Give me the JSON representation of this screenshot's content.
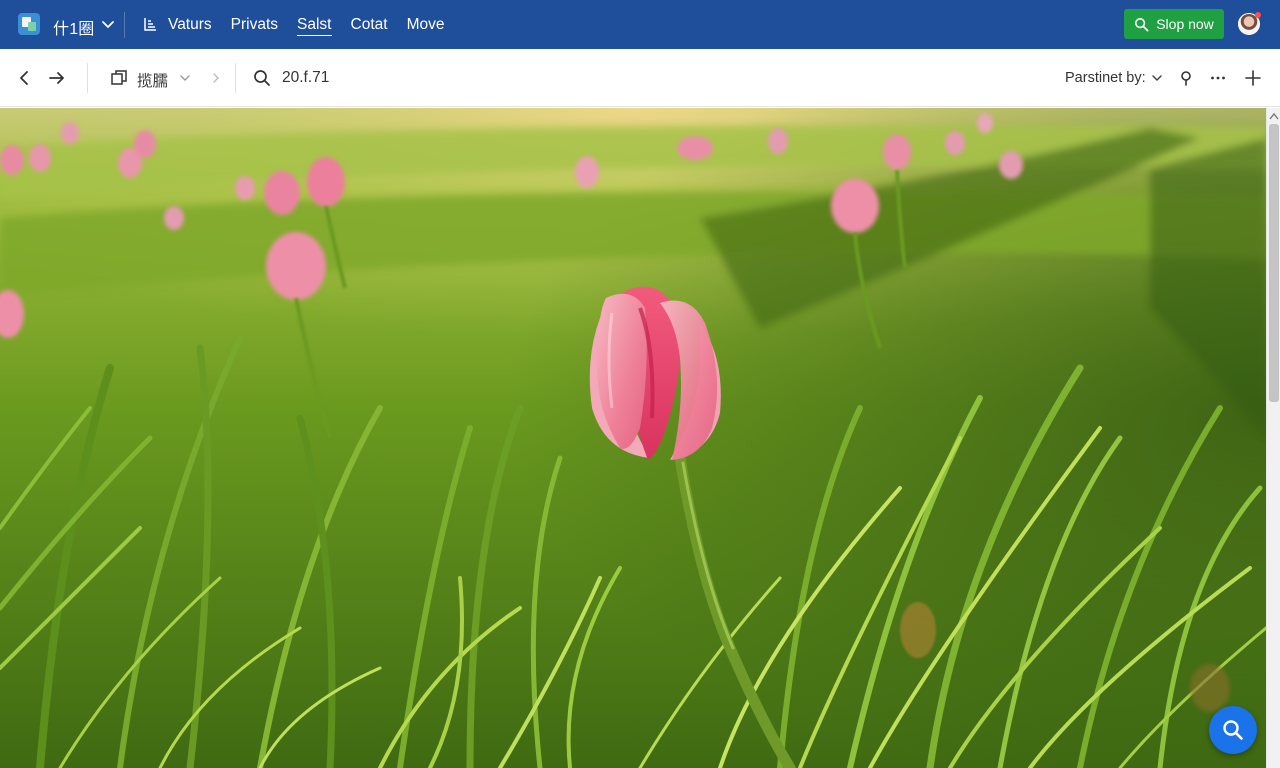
{
  "topbar": {
    "workspace": "什1圈",
    "nav": [
      {
        "label": "Vaturs",
        "active": false
      },
      {
        "label": "Privats",
        "active": false
      },
      {
        "label": "Salst",
        "active": true
      },
      {
        "label": "Cotat",
        "active": false
      },
      {
        "label": "Move",
        "active": false
      }
    ],
    "cta_label": "Slop now",
    "colors": {
      "bar": "#1f4e9a",
      "cta": "#1fa043"
    }
  },
  "toolbar": {
    "folder_label": "揽臑",
    "search_value": "20.f.71",
    "sort_label": "Parstinet by:"
  },
  "icons": {
    "logo": "app-logo-icon",
    "workspace_caret": "chevron-down-icon",
    "nav_icon": "filter-icon",
    "cta_icon": "search-icon",
    "back": "arrow-left-icon",
    "forward": "arrow-right-icon",
    "folder": "window-icon",
    "search": "search-icon",
    "pin": "pin-icon",
    "more": "more-icon",
    "add": "plus-icon",
    "fab": "search-icon"
  },
  "photo": {
    "subject": "pink-tulip-in-grass-field"
  }
}
